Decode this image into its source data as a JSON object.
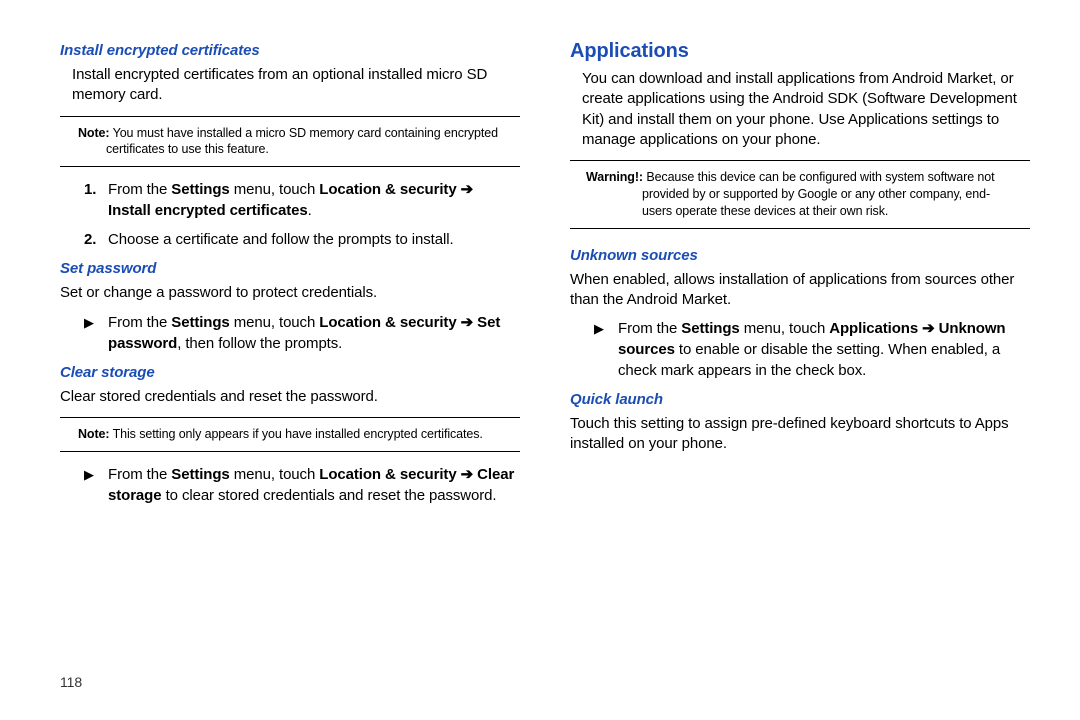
{
  "left": {
    "sec1": {
      "heading": "Install encrypted certificates",
      "para": "Install encrypted certificates from an optional installed micro SD memory card.",
      "note_label": "Note:",
      "note_text": " You must have installed a micro SD memory card containing encrypted certificates to use this feature.",
      "step1_num": "1.",
      "step1_a": "From the ",
      "step1_b": "Settings",
      "step1_c": " menu, touch ",
      "step1_d": "Location & security ",
      "step1_arrow": "➔",
      "step1_e": "Install encrypted certificates",
      "step1_f": ".",
      "step2_num": "2.",
      "step2": "Choose a certificate and follow the prompts to install."
    },
    "sec2": {
      "heading": "Set password",
      "para": "Set or change a password to protect credentials.",
      "bullet": "▶",
      "b_a": "From the ",
      "b_b": "Settings",
      "b_c": " menu, touch ",
      "b_d": "Location & security ",
      "b_arrow": "➔",
      "b_e": " Set password",
      "b_f": ", then follow the prompts."
    },
    "sec3": {
      "heading": "Clear storage",
      "para": "Clear stored credentials and reset the password.",
      "note_label": "Note:",
      "note_text": " This setting only appears if you have installed encrypted certificates.",
      "bullet": "▶",
      "b_a": "From the ",
      "b_b": "Settings",
      "b_c": " menu, touch ",
      "b_d": "Location & security ",
      "b_arrow": "➔",
      "b_e": " Clear storage",
      "b_f": " to clear stored credentials and reset the password."
    }
  },
  "right": {
    "heading": "Applications",
    "para": "You can download and install applications from Android Market, or create applications using the Android SDK (Software Development Kit) and install them on your phone. Use Applications settings to manage applications on your phone.",
    "warn_label": "Warning!:",
    "warn_text": " Because this device can be configured with system software not provided by or supported by Google or any other company, end-users operate these devices at their own risk.",
    "sec1": {
      "heading": "Unknown sources",
      "para": "When enabled, allows installation of applications from sources other than the Android Market.",
      "bullet": "▶",
      "b_a": "From the ",
      "b_b": "Settings",
      "b_c": " menu, touch ",
      "b_d": "Applications ",
      "b_arrow": "➔",
      "b_e": " Unknown sources",
      "b_f": " to enable or disable the setting. When enabled, a check mark appears in the check box."
    },
    "sec2": {
      "heading": "Quick launch",
      "para": "Touch this setting to assign pre-defined keyboard shortcuts to Apps installed on your phone."
    }
  },
  "page_number": "118"
}
